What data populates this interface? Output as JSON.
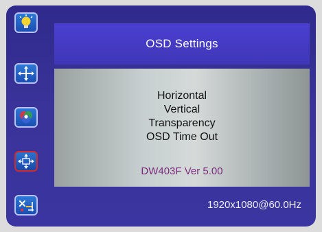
{
  "osd": {
    "header": {
      "title": "OSD Settings"
    },
    "menu_items": [
      "Horizontal",
      "Vertical",
      "Transparency",
      "OSD Time Out"
    ],
    "version": "DW403F Ver 5.00",
    "resolution": "1920x1080@60.0Hz",
    "sidebar_icons": [
      {
        "name": "brightness-icon",
        "selected": false
      },
      {
        "name": "position-icon",
        "selected": false
      },
      {
        "name": "color-icon",
        "selected": false
      },
      {
        "name": "osd-settings-icon",
        "selected": true
      },
      {
        "name": "tools-icon",
        "selected": false
      }
    ],
    "colors": {
      "background": "#3a3399",
      "header": "#4a3fd1",
      "panel": "#c7cfd0",
      "version_text": "#7a2b7b",
      "selected_border": "#d42a2a"
    }
  }
}
